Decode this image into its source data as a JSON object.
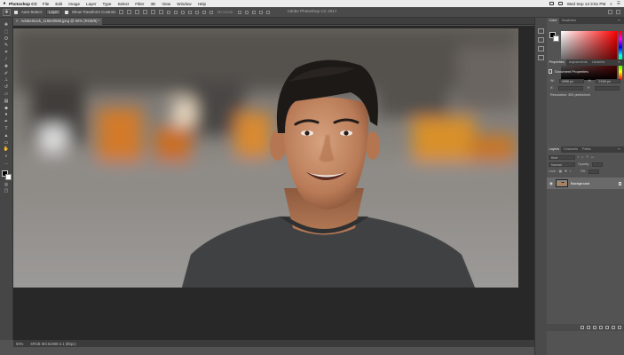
{
  "menubar": {
    "apple_icon": "apple-icon",
    "app_name": "Photoshop CC",
    "items": [
      "File",
      "Edit",
      "Image",
      "Layer",
      "Type",
      "Select",
      "Filter",
      "3D",
      "View",
      "Window",
      "Help"
    ],
    "clock": "Wed Sep 13  3:51 PM"
  },
  "app_title": "Adobe Photoshop CC 2017",
  "options_bar": {
    "auto_select_label": "Auto-Select:",
    "auto_select_value": "Layer",
    "transform_label": "Show Transform Controls",
    "mode_label": "3D Mode:"
  },
  "document": {
    "tab_label": "AdobeStock_115540588.jpeg @ 50% (RGB/8) *",
    "tab_close": "×"
  },
  "status": {
    "zoom": "50%",
    "info": "sRGB IEC61966-2.1 (8bpc)"
  },
  "color_panel": {
    "tabs": [
      "Color",
      "Swatches"
    ]
  },
  "properties_panel": {
    "tabs": [
      "Properties",
      "Adjustments",
      "Libraries"
    ],
    "heading": "Document Properties",
    "w_label": "W:",
    "w_value": "4096 px",
    "h_label": "H:",
    "h_value": "2160 px",
    "x_label": "X:",
    "y_label": "Y:",
    "resolution": "Resolution: 300 pixels/inch"
  },
  "layers_panel": {
    "tabs": [
      "Layers",
      "Channels",
      "Paths"
    ],
    "filter_label": "Kind",
    "blend_mode": "Normal",
    "opacity_label": "Opacity:",
    "lock_label": "Lock:",
    "fill_label": "Fill:",
    "layer_name": "Background"
  },
  "icons": {
    "move_tool": "move-tool-icon",
    "visibility": "eye-icon",
    "lock": "lock-icon"
  }
}
